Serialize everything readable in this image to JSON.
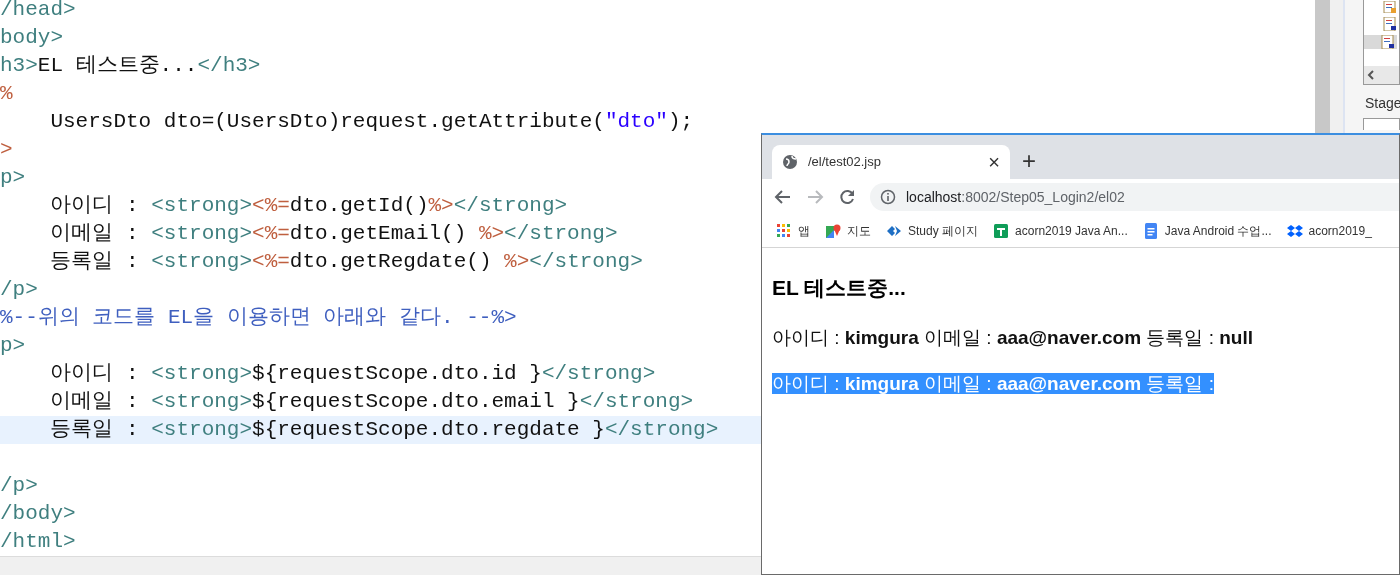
{
  "editor": {
    "lines": [
      {
        "current": false,
        "segments": [
          {
            "kind": "tag",
            "text": "/head>"
          }
        ]
      },
      {
        "current": false,
        "segments": [
          {
            "kind": "tag",
            "text": "body>"
          }
        ]
      },
      {
        "current": false,
        "segments": [
          {
            "kind": "tag",
            "text": "h3>"
          },
          {
            "kind": "text",
            "text": "EL 테스트중..."
          },
          {
            "kind": "tag",
            "text": "</h3>"
          }
        ]
      },
      {
        "current": false,
        "segments": [
          {
            "kind": "scriptlet",
            "text": "%"
          }
        ]
      },
      {
        "current": false,
        "segments": [
          {
            "kind": "text",
            "text": "    UsersDto dto=(UsersDto)request.getAttribute("
          },
          {
            "kind": "string",
            "text": "\"dto\""
          },
          {
            "kind": "text",
            "text": ");"
          }
        ]
      },
      {
        "current": false,
        "segments": [
          {
            "kind": "scriptlet",
            "text": ">"
          }
        ]
      },
      {
        "current": false,
        "segments": [
          {
            "kind": "tag",
            "text": "p>"
          }
        ]
      },
      {
        "current": false,
        "segments": [
          {
            "kind": "text",
            "text": "    아이디 : "
          },
          {
            "kind": "tag",
            "text": "<strong>"
          },
          {
            "kind": "scriptlet",
            "text": "<%="
          },
          {
            "kind": "text",
            "text": "dto.getId()"
          },
          {
            "kind": "scriptlet",
            "text": "%>"
          },
          {
            "kind": "tag",
            "text": "</strong>"
          }
        ]
      },
      {
        "current": false,
        "segments": [
          {
            "kind": "text",
            "text": "    이메일 : "
          },
          {
            "kind": "tag",
            "text": "<strong>"
          },
          {
            "kind": "scriptlet",
            "text": "<%="
          },
          {
            "kind": "text",
            "text": "dto.getEmail() "
          },
          {
            "kind": "scriptlet",
            "text": "%>"
          },
          {
            "kind": "tag",
            "text": "</strong>"
          }
        ]
      },
      {
        "current": false,
        "segments": [
          {
            "kind": "text",
            "text": "    등록일 : "
          },
          {
            "kind": "tag",
            "text": "<strong>"
          },
          {
            "kind": "scriptlet",
            "text": "<%="
          },
          {
            "kind": "text",
            "text": "dto.getRegdate() "
          },
          {
            "kind": "scriptlet",
            "text": "%>"
          },
          {
            "kind": "tag",
            "text": "</strong>"
          }
        ]
      },
      {
        "current": false,
        "segments": [
          {
            "kind": "tag",
            "text": "/p>"
          }
        ]
      },
      {
        "current": false,
        "segments": [
          {
            "kind": "comment",
            "text": "%--위의 코드를 EL을 이용하면 아래와 같다. --%>"
          }
        ]
      },
      {
        "current": false,
        "segments": [
          {
            "kind": "tag",
            "text": "p>"
          }
        ]
      },
      {
        "current": false,
        "segments": [
          {
            "kind": "text",
            "text": "    아이디 : "
          },
          {
            "kind": "tag",
            "text": "<strong>"
          },
          {
            "kind": "text",
            "text": "${requestScope.dto.id }"
          },
          {
            "kind": "tag",
            "text": "</strong>"
          }
        ]
      },
      {
        "current": false,
        "segments": [
          {
            "kind": "text",
            "text": "    이메일 : "
          },
          {
            "kind": "tag",
            "text": "<strong>"
          },
          {
            "kind": "text",
            "text": "${requestScope.dto.email }"
          },
          {
            "kind": "tag",
            "text": "</strong>"
          }
        ]
      },
      {
        "current": true,
        "segments": [
          {
            "kind": "text",
            "text": "    등록일 : "
          },
          {
            "kind": "tag",
            "text": "<strong>"
          },
          {
            "kind": "text",
            "text": "${requestScope.dto.regdate }"
          },
          {
            "kind": "tag",
            "text": "</strong>"
          }
        ]
      },
      {
        "current": false
      },
      {
        "current": false,
        "segments": [
          {
            "kind": "tag",
            "text": "/p>"
          }
        ]
      },
      {
        "current": false,
        "segments": [
          {
            "kind": "tag",
            "text": "/body>"
          }
        ]
      },
      {
        "current": false,
        "segments": [
          {
            "kind": "tag",
            "text": "/html>"
          }
        ]
      }
    ]
  },
  "side_panel": {
    "label": "Stage"
  },
  "browser": {
    "tab": {
      "title": "/el/test02.jsp",
      "close": "×"
    },
    "new_tab": "+",
    "address": {
      "host": "localhost",
      "path": ":8002/Step05_Login2/el02"
    },
    "bookmarks": [
      {
        "kind": "apps",
        "label": "앱"
      },
      {
        "kind": "maps",
        "label": "지도"
      },
      {
        "kind": "study",
        "label": "Study 페이지"
      },
      {
        "kind": "sheets",
        "label": "acorn2019 Java An..."
      },
      {
        "kind": "docs",
        "label": "Java Android 수업..."
      },
      {
        "kind": "dropbox",
        "label": "acorn2019_"
      }
    ],
    "page": {
      "heading": "EL 테스트중...",
      "paragraphs": [
        {
          "selected": false,
          "text": "아이디 : **kimgura** 이메일 : **aaa@naver.com** 등록일 : **null**"
        },
        {
          "selected": true,
          "text": "아이디 : **kimgura** 이메일 : **aaa@naver.com** 등록일 :"
        }
      ]
    }
  }
}
